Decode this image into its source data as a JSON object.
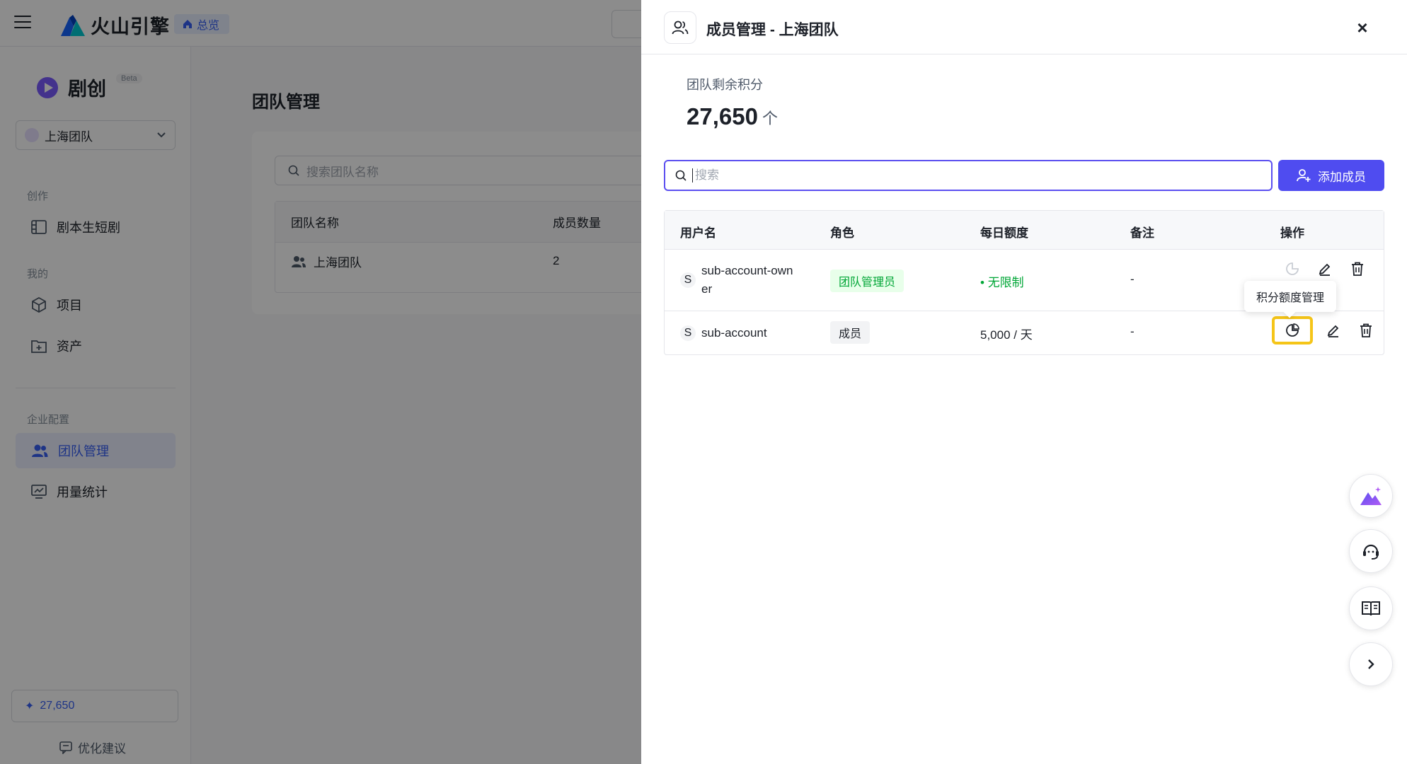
{
  "topbar": {
    "brand": "火山引擎",
    "home_label": "总览"
  },
  "sidebar": {
    "product_name": "剧创",
    "badge": "Beta",
    "team_select": "上海团队",
    "groups": {
      "create": "创作",
      "mine": "我的",
      "enterprise": "企业配置"
    },
    "items": {
      "script_drama": "剧本生短剧",
      "projects": "项目",
      "assets": "资产",
      "team_mgmt": "团队管理",
      "usage_stats": "用量统计"
    },
    "credits": "27,650",
    "feedback": "优化建议"
  },
  "main": {
    "title": "团队管理",
    "search_placeholder": "搜索团队名称",
    "table": {
      "col_name": "团队名称",
      "col_members": "成员数量",
      "row_name": "上海团队",
      "row_members": "2"
    }
  },
  "drawer": {
    "title": "成员管理 - 上海团队",
    "close": "×",
    "points_label": "团队剩余积分",
    "points_value": "27,650",
    "points_unit": "个",
    "search_placeholder": "搜索",
    "add_button": "添加成员",
    "table": {
      "headers": {
        "user": "用户名",
        "role": "角色",
        "quota": "每日额度",
        "note": "备注",
        "ops": "操作"
      },
      "rows": [
        {
          "initial": "S",
          "username": "sub-account-owner",
          "role": "团队管理员",
          "quota": "无限制",
          "note": "-"
        },
        {
          "initial": "S",
          "username": "sub-account",
          "role": "成员",
          "quota": "5,000 / 天",
          "note": "-"
        }
      ]
    },
    "tooltip": "积分额度管理"
  },
  "colors": {
    "accent": "#4f4cf0",
    "highlight": "#f5c518",
    "success": "#00a636"
  }
}
